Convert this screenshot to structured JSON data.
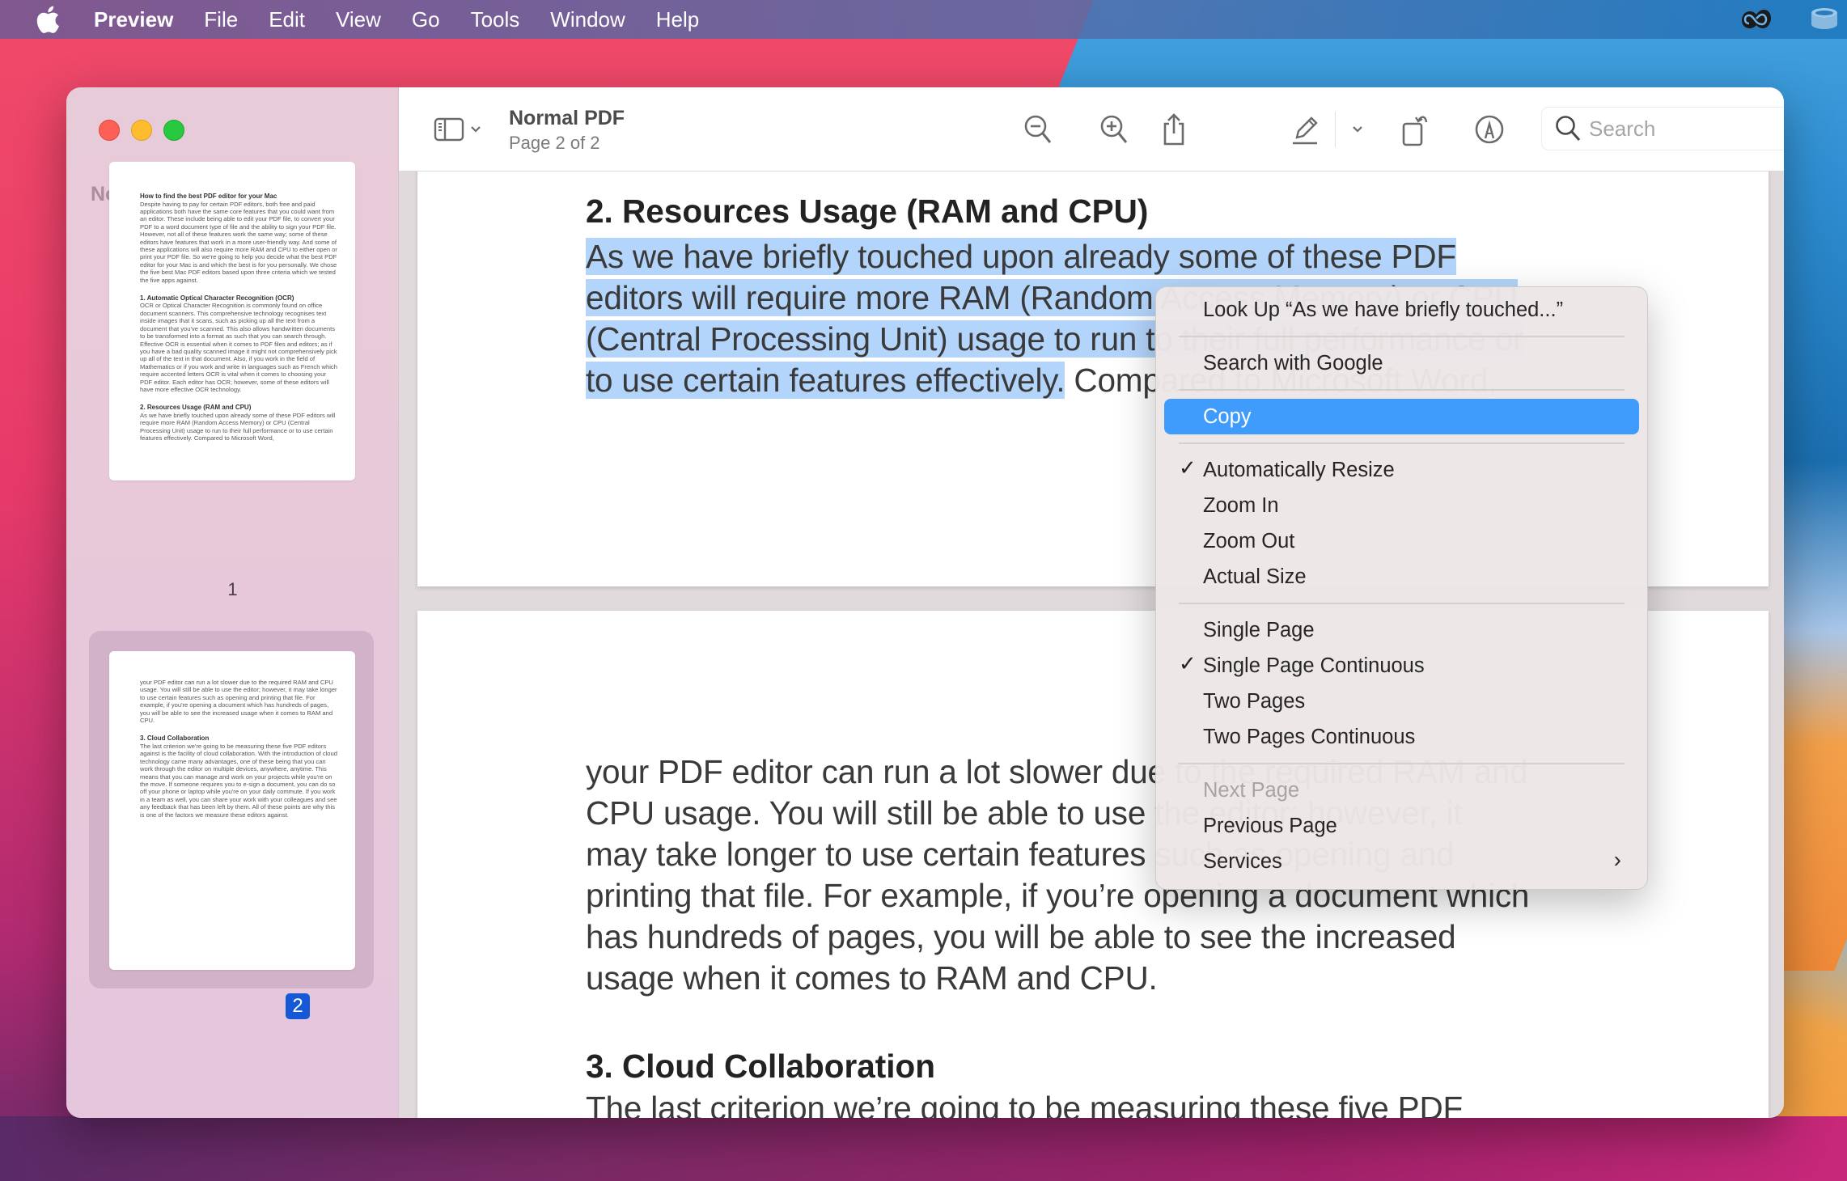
{
  "menubar": {
    "app_name": "Preview",
    "items": [
      "File",
      "Edit",
      "View",
      "Go",
      "Tools",
      "Window",
      "Help"
    ],
    "tray_icons": [
      "creative-cloud-icon",
      "storage-icon"
    ]
  },
  "window": {
    "sidebar": {
      "title": "Normal PDF",
      "thumbnails": [
        {
          "label": "1",
          "selected": false,
          "blocks": [
            {
              "type": "heading",
              "text": "How to find the best PDF editor for your Mac"
            },
            {
              "type": "para",
              "text": "Despite having to pay for certain PDF editors, both free and paid applications both have the same core features that you could want from an editor. These include being able to edit your PDF file, to convert your PDF to a word document type of file and the ability to sign your PDF file. However, not all of these features work the same way; some of these editors have features that work in a more user-friendly way. And some of these applications will also require more RAM and CPU to either open or print your PDF file. So we're going to help you decide what the best PDF editor for your Mac is and which the best is for you personally. We chose the five best Mac PDF editors based upon three criteria which we tested the five apps against."
            },
            {
              "type": "heading",
              "text": "1. Automatic Optical Character Recognition (OCR)"
            },
            {
              "type": "para",
              "text": "OCR or Optical Character Recognition is commonly found on office document scanners. This comprehensive technology recognises text inside images that it scans, such as picking up all the text from a document that you've scanned. This also allows handwritten documents to be transformed into a format as such that you can search through. Effective OCR is essential when it comes to PDF files and editors; as if you have a bad quality scanned image it might not comprehensively pick up all of the text in that document. Also, if you work in the field of Mathematics or if you work and write in languages such as French which require accented letters OCR is vital when it comes to choosing your PDF editor. Each editor has OCR; however, some of these editors will have more effective OCR technology."
            },
            {
              "type": "heading",
              "text": "2. Resources Usage (RAM and CPU)"
            },
            {
              "type": "para",
              "text": "As we have briefly touched upon already some of these PDF editors will require more RAM (Random Access Memory) or CPU (Central Processing Unit) usage to run to their full performance or to use certain features effectively. Compared to Microsoft Word,"
            }
          ]
        },
        {
          "label": "2",
          "selected": true,
          "blocks": [
            {
              "type": "para",
              "text": "your PDF editor can run a lot slower due to the required RAM and CPU usage. You will still be able to use the editor; however, it may take longer to use certain features such as opening and printing that file. For example, if you're opening a document which has hundreds of pages, you will be able to see the increased usage when it comes to RAM and CPU."
            },
            {
              "type": "heading",
              "text": "3. Cloud Collaboration"
            },
            {
              "type": "para",
              "text": "The last criterion we're going to be measuring these five PDF editors against is the facility of cloud collaboration. With the introduction of cloud technology came many advantages, one of these being that you can work through the editor on multiple devices, anywhere, anytime. This means that you can manage and work on your projects while you're on the move. If someone requires you to e-sign a document, you can do so off your phone or laptop while you're on your daily commute. If you work in a team as well, you can share your work with your colleagues and see any feedback that has been left by them. All of these points are why this is one of the factors we measure these editors against."
            }
          ]
        }
      ]
    },
    "toolbar": {
      "doc_title": "Normal PDF",
      "page_info": "Page 2 of 2",
      "search_placeholder": "Search"
    },
    "document": {
      "page1": {
        "heading": "2. Resources Usage (RAM and CPU)",
        "lines": [
          {
            "text": "As we have briefly touched upon already some of these PDF",
            "selected": "As we have briefly touched upon already some of these PDF",
            "rest": ""
          },
          {
            "text": "editors will require more RAM (Random Access Memory) or CPU",
            "selected": "editors will require more RAM (Random Access Memory) or CPU",
            "rest": ""
          },
          {
            "text": "(Central Processing Unit) usage to run to their full performance or",
            "selected": "(Central Processing Unit) usage to run to their full performance or",
            "rest": ""
          },
          {
            "text": "to use certain features effectively. Compared to Microsoft Word,",
            "selected": "to use certain features effectively.",
            "rest": " Compared to Microsoft Word,"
          }
        ]
      },
      "page2": {
        "lines": [
          "your PDF editor can run a lot slower due to the required RAM and",
          "CPU usage. You will still be able to use the editor; however, it",
          "may take longer to use certain features such as opening and",
          "printing that file. For example, if you’re opening a document which",
          "has hundreds of pages, you will be able to see the increased",
          "usage when it comes to RAM and CPU."
        ],
        "heading": "3. Cloud Collaboration",
        "next_line": "The last criterion we’re going to be measuring these five PDF"
      }
    },
    "context_menu": {
      "groups": [
        [
          {
            "label": "Look Up “As we have briefly touched...”"
          }
        ],
        [
          {
            "label": "Search with Google"
          }
        ],
        [
          {
            "label": "Copy",
            "highlighted": true
          }
        ],
        [
          {
            "label": "Automatically Resize",
            "checked": true
          },
          {
            "label": "Zoom In"
          },
          {
            "label": "Zoom Out"
          },
          {
            "label": "Actual Size"
          }
        ],
        [
          {
            "label": "Single Page"
          },
          {
            "label": "Single Page Continuous",
            "checked": true
          },
          {
            "label": "Two Pages"
          },
          {
            "label": "Two Pages Continuous"
          }
        ],
        [
          {
            "label": "Next Page",
            "disabled": true
          },
          {
            "label": "Previous Page"
          },
          {
            "label": "Services",
            "submenu": true
          }
        ]
      ],
      "check_glyph": "✓",
      "submenu_glyph": "›"
    }
  },
  "colors": {
    "selection_highlight": "#b4d5fb",
    "menu_highlight": "#3f9bfc",
    "page_badge": "#1559d6",
    "sidebar_bg": "#e8cbd8"
  }
}
